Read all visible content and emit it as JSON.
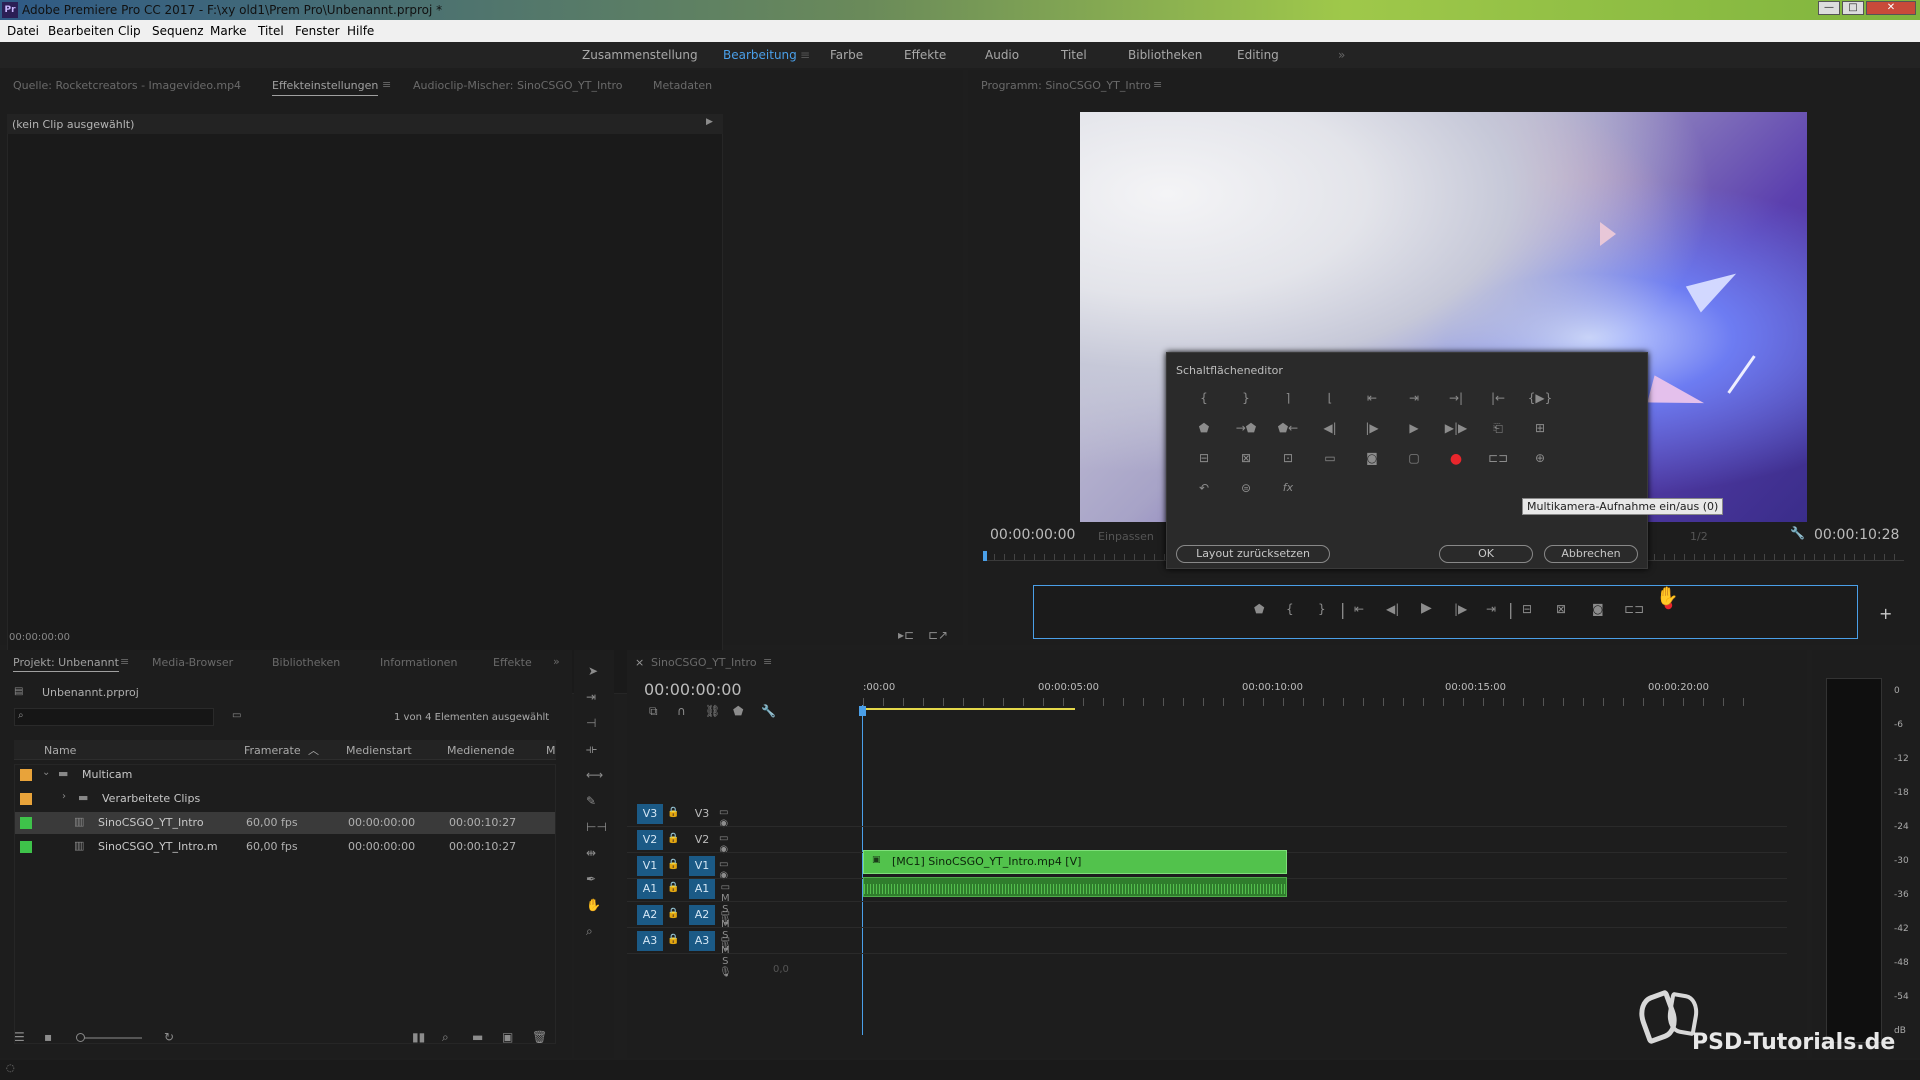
{
  "window": {
    "title": "Adobe Premiere Pro CC 2017 - F:\\xy old1\\Prem Pro\\Unbenannt.prproj *",
    "logo": "Pr",
    "minimize": "—",
    "maximize": "□",
    "close": "✕"
  },
  "menu": [
    "Datei",
    "Bearbeiten",
    "Clip",
    "Sequenz",
    "Marke",
    "Titel",
    "Fenster",
    "Hilfe"
  ],
  "workspaces": {
    "items": [
      "Zusammenstellung",
      "Bearbeitung",
      "Farbe",
      "Effekte",
      "Audio",
      "Titel",
      "Bibliotheken",
      "Editing"
    ],
    "active": "Bearbeitung",
    "more": "»"
  },
  "source_panel": {
    "tabs": [
      "Quelle: Rocketcreators - Imagevideo.mp4",
      "Effekteinstellungen",
      "Audioclip-Mischer: SinoCSGO_YT_Intro",
      "Metadaten"
    ],
    "active": "Effekteinstellungen",
    "no_clip": "(kein Clip ausgewählt)",
    "timecode": "00:00:00:00"
  },
  "program": {
    "tab": "Programm: SinoCSGO_YT_Intro",
    "timecode_left": "00:00:00:00",
    "fit": "Einpassen",
    "zoom": "1/2",
    "timecode_right": "00:00:10:28"
  },
  "button_editor": {
    "title": "Schaltflächeneditor",
    "tooltip": "Multikamera-Aufnahme ein/aus (0)",
    "reset": "Layout zurücksetzen",
    "ok": "OK",
    "cancel": "Abbrechen",
    "rows": [
      [
        "mark-in-icon",
        "mark-out-icon",
        "mark-clip-in-icon",
        "mark-clip-out-icon",
        "go-to-in-icon",
        "go-to-out-icon",
        "go-to-next-edit-icon",
        "go-to-previous-edit-icon",
        "play-in-to-out-icon"
      ],
      [
        "add-marker-icon",
        "go-to-next-marker-icon",
        "go-to-previous-marker-icon",
        "step-back-icon",
        "step-forward-icon",
        "play-icon",
        "loop-icon",
        "lift-icon",
        "extract-icon"
      ],
      [
        "insert-icon",
        "overwrite-icon",
        "trim-icon",
        "safe-margins-icon",
        "export-frame-icon",
        "comparison-view-icon",
        "multicam-record-icon",
        "multicam-view-icon",
        "vr-video-icon"
      ],
      [
        "restore-icon",
        "global-fx-icon",
        "fx-icon"
      ]
    ],
    "glyphs": {
      "row0": [
        "{",
        "}",
        "⌉",
        "⌊",
        "⇤",
        "⇥",
        "→|",
        "|←",
        "{▶}"
      ],
      "row1": [
        "⬟",
        "→⬟",
        "⬟←",
        "◀|",
        "|▶",
        "▶",
        "▶|▶",
        "⎗",
        "⊞"
      ],
      "row2": [
        "⊟",
        "⊠",
        "⊡",
        "▭",
        "◙",
        "▢",
        "●",
        "⊏⊐",
        "⊕"
      ],
      "row3": [
        "↶",
        "⊜",
        "fx"
      ]
    }
  },
  "transport": {
    "glyphs": [
      "⬟",
      "{",
      "}",
      "|",
      "⇤",
      "◀|",
      "▶",
      "|▶",
      "⇥",
      "|",
      "⊟",
      "⊠",
      "◙",
      "⊏⊐",
      "●"
    ],
    "add": "+"
  },
  "project": {
    "tabs": [
      "Projekt: Unbenannt",
      "Media-Browser",
      "Bibliotheken",
      "Informationen",
      "Effekte"
    ],
    "file": "Unbenannt.prproj",
    "selection": "1 von 4 Elementen ausgewählt",
    "columns": [
      "Name",
      "Framerate",
      "Medienstart",
      "Medienende",
      "M"
    ],
    "rows": [
      {
        "name": "Multicam",
        "type": "folder",
        "fps": "",
        "start": "",
        "end": "",
        "color": "#e8a33a"
      },
      {
        "name": "Verarbeitete Clips",
        "type": "folder",
        "fps": "",
        "start": "",
        "end": "",
        "color": "#e8a33a"
      },
      {
        "name": "SinoCSGO_YT_Intro",
        "type": "sequence",
        "fps": "60,00 fps",
        "start": "00:00:00:00",
        "end": "00:00:10:27",
        "color": "#3ec24a"
      },
      {
        "name": "SinoCSGO_YT_Intro.m",
        "type": "sequence",
        "fps": "60,00 fps",
        "start": "00:00:00:00",
        "end": "00:00:10:27",
        "color": "#3ec24a"
      }
    ]
  },
  "timeline": {
    "tab": "SinoCSGO_YT_Intro",
    "timecode": "00:00:00:00",
    "ruler": [
      ":00:00",
      "00:00:05:00",
      "00:00:10:00",
      "00:00:15:00",
      "00:00:20:00"
    ],
    "video_tracks": [
      "V3",
      "V2",
      "V1"
    ],
    "audio_tracks": [
      "A1",
      "A2",
      "A3"
    ],
    "clip_label": "[MC1] SinoCSGO_YT_Intro.mp4 [V]",
    "master_value": "0,0"
  },
  "meter": {
    "scale": [
      "0",
      "-6",
      "-12",
      "-18",
      "-24",
      "-30",
      "-36",
      "-42",
      "-48",
      "-54",
      "dB"
    ]
  },
  "watermark": "PSD-Tutorials.de",
  "colors": {
    "accent": "#4a9fe8",
    "clip_green": "#52c24c",
    "track_blue": "#1b5a86",
    "record_red": "#e8262c"
  }
}
